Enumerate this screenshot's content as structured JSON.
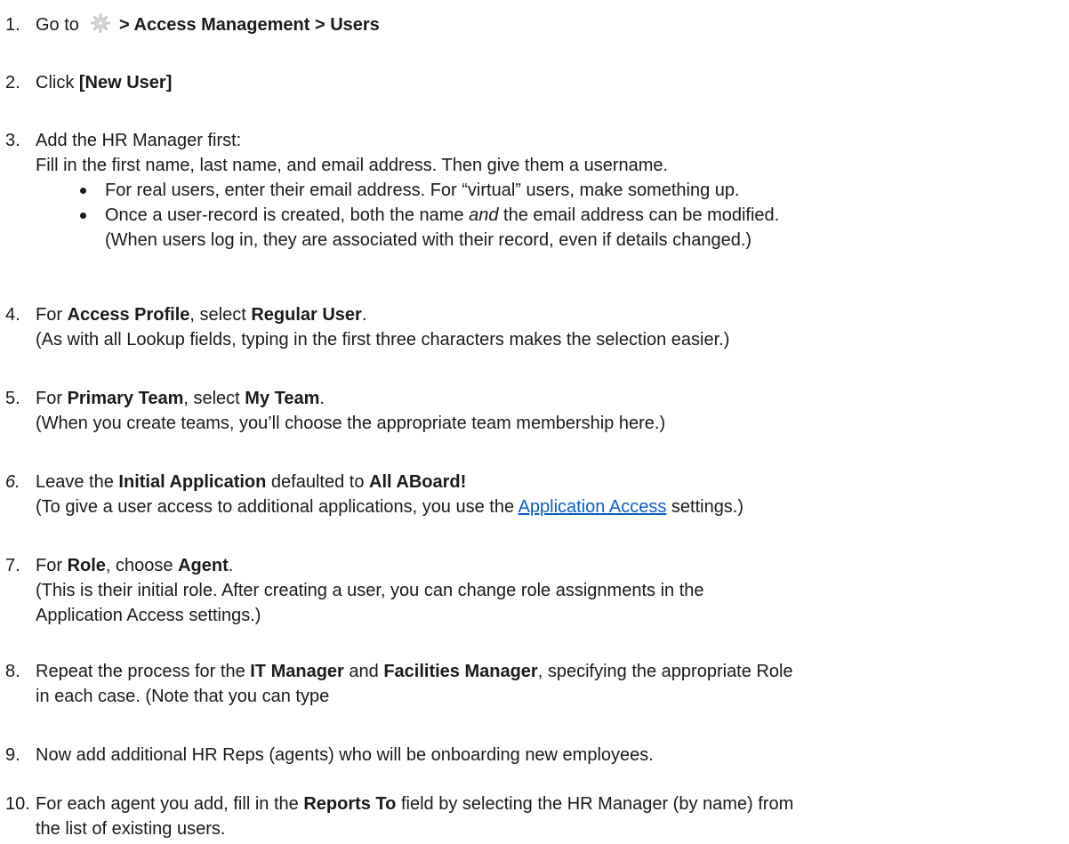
{
  "steps": [
    {
      "num": "1.",
      "pre": "Go to ",
      "bold": " > Access Management > Users",
      "icon": "gear-icon"
    },
    {
      "num": "2.",
      "pre": "Click ",
      "bold": "[New User]"
    },
    {
      "num": "3.",
      "line1": "Add the HR Manager first:",
      "line2": "Fill in the first name, last name, and email address. Then give them a username.",
      "bullets": [
        {
          "text": "For real users, enter their email address. For “virtual” users, make something up."
        },
        {
          "pre": "Once a user-record is created, both the name ",
          "italic": "and",
          "post": " the email address can be modified.",
          "line2": "(When users log in, they are associated with their record, even if details changed.)"
        }
      ]
    },
    {
      "num": "4.",
      "t1": "For ",
      "b1": "Access Profile",
      "t2": ", select ",
      "b2": "Regular User",
      "t3": ".",
      "line2": "(As with all Lookup fields, typing in the first three characters makes the selection easier.)"
    },
    {
      "num": "5.",
      "t1": "For ",
      "b1": "Primary Team",
      "t2": ", select ",
      "b2": "My Team",
      "t3": ".",
      "line2": "(When you create teams, you’ll choose the appropriate team membership here.)"
    },
    {
      "num": "6.",
      "t1": "Leave the ",
      "b1": "Initial Application",
      "t2": " defaulted to ",
      "b2": "All ABoard!",
      "pre2": "(To give a user access to additional applications, you use the ",
      "link": "Application Access",
      "post2": " settings.)"
    },
    {
      "num": "7.",
      "t1": "For ",
      "b1": "Role",
      "t2": ", choose ",
      "b2": "Agent",
      "t3": ".",
      "line2": "(This is their initial role. After creating a user, you can change role assignments in the",
      "line3": "Application Access settings.)"
    },
    {
      "num": "8.",
      "t1": "Repeat the process for the ",
      "b1": "IT Manager",
      "t2": " and ",
      "b2": "Facilities Manager",
      "t3": ", specifying the appropriate Role",
      "line2": "in each case. (Note that you can type"
    },
    {
      "num": "9.",
      "text": "Now add additional HR Reps (agents) who will be onboarding new employees."
    },
    {
      "num": "10.",
      "t1": "For each agent you add, fill in the ",
      "b1": "Reports To",
      "t2": " field by selecting the HR Manager (by name) from",
      "line2": "the list of existing users."
    }
  ]
}
